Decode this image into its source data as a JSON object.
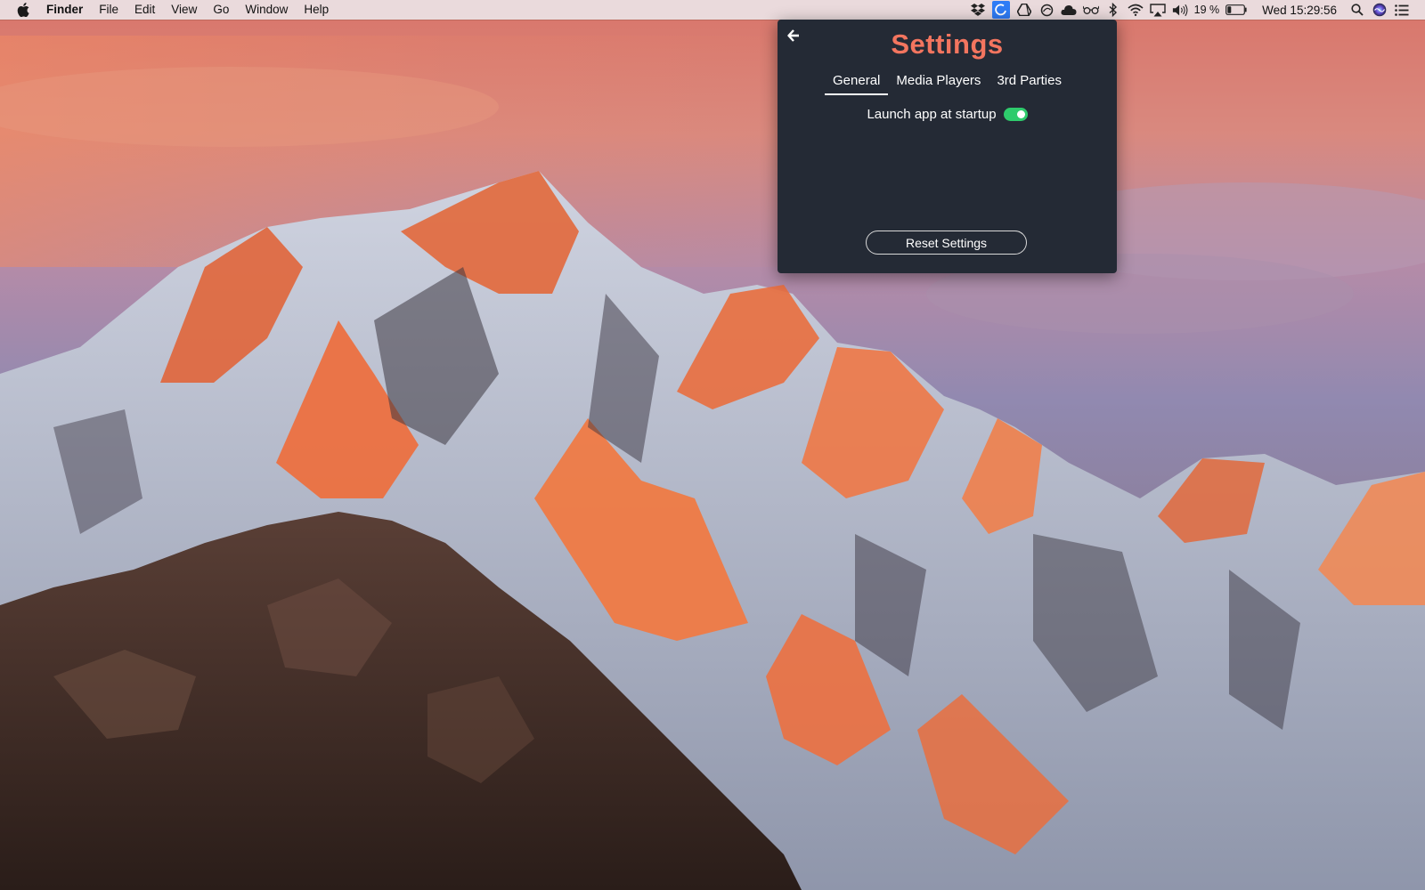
{
  "menubar": {
    "app_name": "Finder",
    "menus": [
      "File",
      "Edit",
      "View",
      "Go",
      "Window",
      "Help"
    ],
    "battery_percent": "19 %",
    "clock": "Wed 15:29:56",
    "tray_icons": [
      "dropbox-icon",
      "app-active-icon",
      "google-drive-icon",
      "sync-circle-icon",
      "cloud-app-icon",
      "glasses-icon",
      "bluetooth-icon",
      "wifi-icon",
      "airplay-icon",
      "volume-icon",
      "battery-icon",
      "spotlight-search-icon",
      "siri-icon",
      "notification-center-icon"
    ]
  },
  "settings": {
    "back_icon": "arrow-left-icon",
    "title": "Settings",
    "tabs": [
      {
        "label": "General",
        "selected": true
      },
      {
        "label": "Media Players",
        "selected": false
      },
      {
        "label": "3rd Parties",
        "selected": false
      }
    ],
    "launch_at_startup": {
      "label": "Launch app at startup",
      "enabled": true
    },
    "reset_button_label": "Reset Settings"
  },
  "colors": {
    "panel_bg": "#242a35",
    "title": "#f3755f",
    "toggle_on": "#2ecb6c",
    "menubar_active_icon_bg": "#2f7cf6"
  }
}
